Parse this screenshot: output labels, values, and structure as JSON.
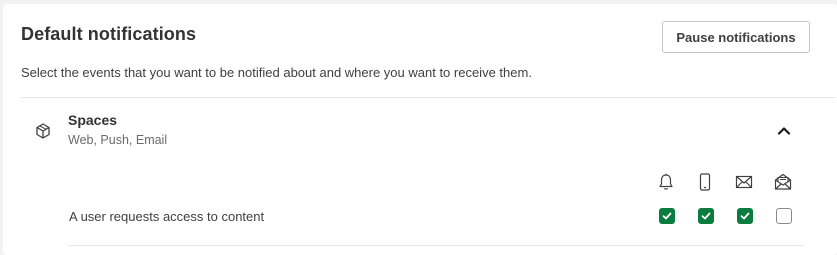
{
  "header": {
    "title": "Default notifications",
    "pause_button_label": "Pause notifications",
    "description": "Select the events that you want to be notified about and where you want to receive them."
  },
  "sections": [
    {
      "title": "Spaces",
      "subtitle": "Web, Push, Email",
      "icon": "cube-icon",
      "expanded": true,
      "channels": [
        {
          "name": "web",
          "icon": "bell-icon"
        },
        {
          "name": "push",
          "icon": "mobile-phone-icon"
        },
        {
          "name": "email",
          "icon": "envelope-icon"
        },
        {
          "name": "digest",
          "icon": "open-envelope-icon"
        }
      ],
      "events": [
        {
          "label": "A user requests access to content",
          "settings": [
            true,
            true,
            true,
            false
          ]
        }
      ]
    }
  ],
  "colors": {
    "check_green": "#0a7d3e",
    "text": "#404040",
    "background": "#f2f2f2"
  }
}
